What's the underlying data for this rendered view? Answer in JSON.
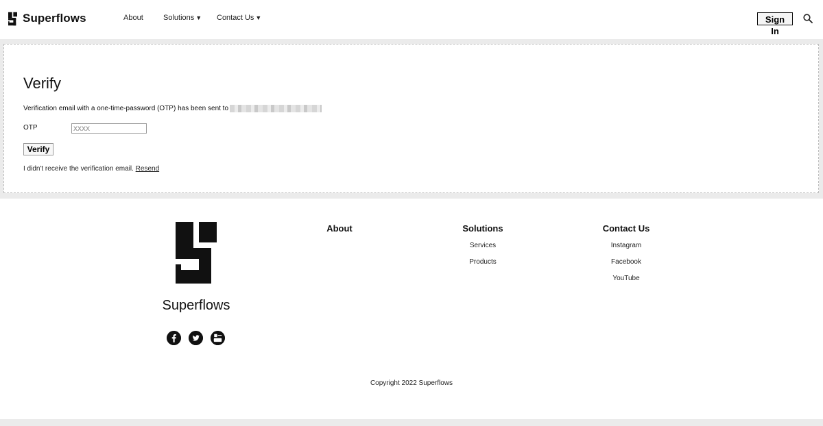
{
  "header": {
    "brand": "Superflows",
    "nav": {
      "about": "About",
      "solutions": "Solutions",
      "contact": "Contact Us",
      "caret": "▼"
    },
    "signin_label": "Sign In",
    "search_icon": "search-icon"
  },
  "verify": {
    "title": "Verify",
    "message": "Verification email with a one-time-password (OTP) has been sent to",
    "otp_label": "OTP",
    "otp_placeholder": "XXXX",
    "otp_value": "",
    "button_label": "Verify",
    "no_email_text": "I didn't receive the verification email.",
    "resend_label": "Resend"
  },
  "footer": {
    "brand": "Superflows",
    "columns": [
      {
        "title": "About",
        "links": []
      },
      {
        "title": "Solutions",
        "links": [
          "Services",
          "Products"
        ]
      },
      {
        "title": "Contact Us",
        "links": [
          "Instagram",
          "Facebook",
          "YouTube"
        ]
      }
    ],
    "social_icons": [
      "facebook-icon",
      "twitter-icon",
      "youtube-icon"
    ],
    "copyright": "Copyright 2022 Superflows"
  },
  "colors": {
    "background": "#ebebeb",
    "surface": "#ffffff",
    "text": "#111111"
  }
}
